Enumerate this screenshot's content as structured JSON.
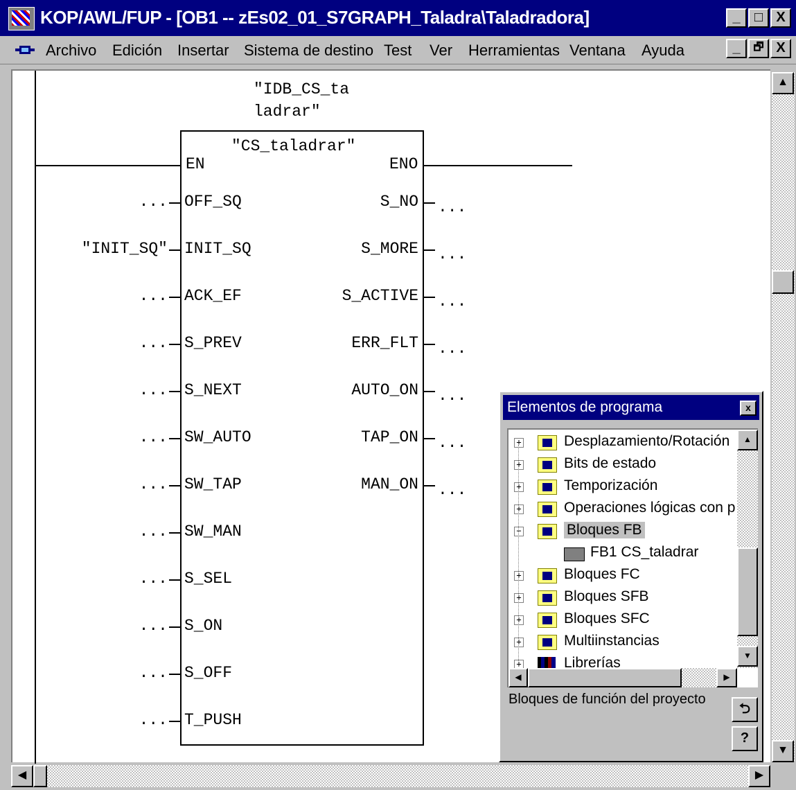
{
  "window": {
    "title": "KOP/AWL/FUP  - [OB1 -- zEs02_01_S7GRAPH_Taladra\\Taladradora]",
    "caption_buttons": [
      "_",
      "□",
      "X"
    ],
    "doc_buttons": [
      "_",
      "🗗",
      "X"
    ]
  },
  "menu": [
    "Archivo",
    "Edición",
    "Insertar",
    "Sistema de destino",
    "Test",
    "Ver",
    "Herramientas",
    "Ventana",
    "Ayuda"
  ],
  "block": {
    "instance_db_line1": "\"IDB_CS_ta",
    "instance_db_line2": "ladrar\"",
    "name": "\"CS_taladrar\"",
    "en": "EN",
    "eno": "ENO",
    "inputs": [
      {
        "arg": "...",
        "pin": "OFF_SQ"
      },
      {
        "arg": "\"INIT_SQ\"",
        "pin": "INIT_SQ"
      },
      {
        "arg": "...",
        "pin": "ACK_EF"
      },
      {
        "arg": "...",
        "pin": "S_PREV"
      },
      {
        "arg": "...",
        "pin": "S_NEXT"
      },
      {
        "arg": "...",
        "pin": "SW_AUTO"
      },
      {
        "arg": "...",
        "pin": "SW_TAP"
      },
      {
        "arg": "...",
        "pin": "SW_MAN"
      },
      {
        "arg": "...",
        "pin": "S_SEL"
      },
      {
        "arg": "...",
        "pin": "S_ON"
      },
      {
        "arg": "...",
        "pin": "S_OFF"
      },
      {
        "arg": "...",
        "pin": "T_PUSH"
      }
    ],
    "outputs": [
      {
        "pin": "S_NO",
        "arg": "..."
      },
      {
        "pin": "S_MORE",
        "arg": "..."
      },
      {
        "pin": "S_ACTIVE",
        "arg": "..."
      },
      {
        "pin": "ERR_FLT",
        "arg": "..."
      },
      {
        "pin": "AUTO_ON",
        "arg": "..."
      },
      {
        "pin": "TAP_ON",
        "arg": "..."
      },
      {
        "pin": "MAN_ON",
        "arg": "..."
      }
    ]
  },
  "panel": {
    "title": "Elementos de programa",
    "close": "x",
    "tree": [
      {
        "expander": "+",
        "label": "Desplazamiento/Rotación",
        "icon": "folder-icon",
        "selected": false
      },
      {
        "expander": "+",
        "label": "Bits de estado",
        "icon": "folder-icon",
        "selected": false
      },
      {
        "expander": "+",
        "label": "Temporización",
        "icon": "timer-folder-icon",
        "selected": false
      },
      {
        "expander": "+",
        "label": "Operaciones lógicas con p",
        "icon": "folder-icon",
        "selected": false
      },
      {
        "expander": "−",
        "label": "Bloques FB",
        "icon": "block-folder-icon",
        "selected": true
      },
      {
        "expander": "",
        "label": "FB1     CS_taladrar",
        "icon": "function-block-icon",
        "selected": false,
        "child": true
      },
      {
        "expander": "+",
        "label": "Bloques FC",
        "icon": "block-folder-icon",
        "selected": false
      },
      {
        "expander": "+",
        "label": "Bloques SFB",
        "icon": "block-folder-icon",
        "selected": false
      },
      {
        "expander": "+",
        "label": "Bloques SFC",
        "icon": "block-folder-icon",
        "selected": false
      },
      {
        "expander": "+",
        "label": "Multiinstancias",
        "icon": "block-folder-icon",
        "selected": false
      },
      {
        "expander": "+",
        "label": "Librerías",
        "icon": "library-icon",
        "selected": false
      }
    ],
    "description": "Bloques de función del proyecto",
    "btn_insert": "⮌",
    "btn_help": "?"
  },
  "colors": {
    "titlebar": "#000080",
    "face": "#c0c0c0",
    "selection": "#c0c0c0"
  }
}
